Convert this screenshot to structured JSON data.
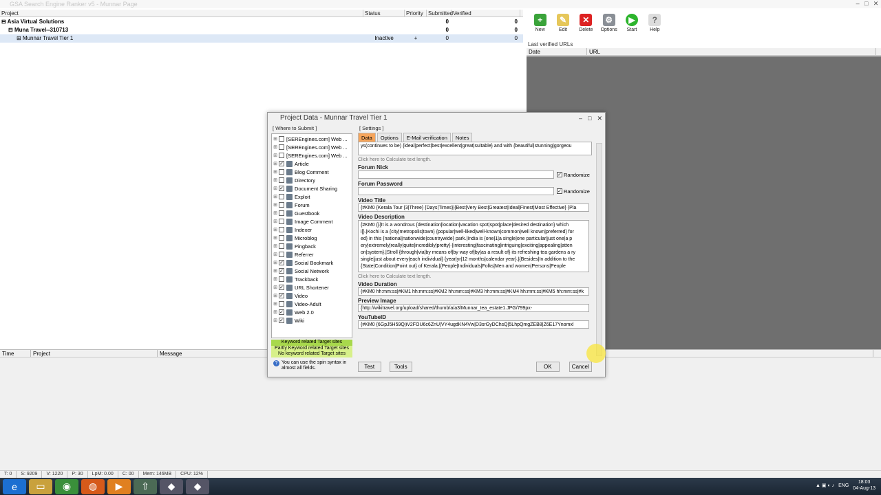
{
  "app_title": "GSA Search Engine Ranker v5 - Munnar Page",
  "projects": {
    "headers": [
      "Project",
      "Status",
      "Priority",
      "Submitted",
      "Verified"
    ],
    "rows": [
      {
        "name": "Asia Virtual Solutions",
        "status": "",
        "priority": "",
        "submitted": "0",
        "verified": "0",
        "indent": "0"
      },
      {
        "name": "Muna Travel--310713",
        "status": "",
        "priority": "",
        "submitted": "0",
        "verified": "0",
        "indent": "1"
      },
      {
        "name": "Munnar Travel Tier 1",
        "status": "Inactive",
        "priority": "+",
        "submitted": "0",
        "verified": "0",
        "indent": "2"
      }
    ]
  },
  "toolbar": {
    "new": "New",
    "edit": "Edit",
    "delete": "Delete",
    "options": "Options",
    "start": "Start",
    "help": "Help"
  },
  "last_verified": {
    "title": "Last verified URLs",
    "date": "Date",
    "url": "URL"
  },
  "log": {
    "time": "Time",
    "project": "Project",
    "message": "Message"
  },
  "status": [
    "T: 0",
    "S: 9209",
    "V: 1220",
    "P: 30",
    "LpM: 0.00",
    "C: 00",
    "Mem: 146MB",
    "CPU: 12%"
  ],
  "clock": {
    "time": "18:03",
    "date": "04-Aug-13",
    "lang": "ENG"
  },
  "dialog": {
    "title": "Project Data - Munnar Travel Tier 1",
    "where_label": "[ Where to Submit ]",
    "settings_label": "[ Settings ]",
    "tabs": [
      "Data",
      "Options",
      "E-Mail verification",
      "Notes"
    ],
    "tree": [
      {
        "label": "[SEREngines.com] Web ...",
        "checked": false
      },
      {
        "label": "[SEREngines.com] Web ...",
        "checked": false
      },
      {
        "label": "[SEREngines.com] Web ...",
        "checked": false
      },
      {
        "label": "Article",
        "checked": true
      },
      {
        "label": "Blog Comment",
        "checked": false
      },
      {
        "label": "Directory",
        "checked": false
      },
      {
        "label": "Document Sharing",
        "checked": true
      },
      {
        "label": "Exploit",
        "checked": false
      },
      {
        "label": "Forum",
        "checked": false
      },
      {
        "label": "Guestbook",
        "checked": false
      },
      {
        "label": "Image Comment",
        "checked": false
      },
      {
        "label": "Indexer",
        "checked": false
      },
      {
        "label": "Microblog",
        "checked": false
      },
      {
        "label": "Pingback",
        "checked": false
      },
      {
        "label": "Referrer",
        "checked": false
      },
      {
        "label": "Social Bookmark",
        "checked": true
      },
      {
        "label": "Social Network",
        "checked": true
      },
      {
        "label": "Trackback",
        "checked": false
      },
      {
        "label": "URL Shortener",
        "checked": true
      },
      {
        "label": "Video",
        "checked": true
      },
      {
        "label": "Video-Adult",
        "checked": false
      },
      {
        "label": "Web 2.0",
        "checked": true
      },
      {
        "label": "Wiki",
        "checked": true
      }
    ],
    "legend": [
      "Keyword related Target sites",
      "Partly Keyword related Target sites",
      "No keyword related Target sites"
    ],
    "spin_note": "You can use the spin syntax in almost all fields.",
    "top_text": "ys(continues to be) {ideal|perfect|best|excellent|great|suitable} and with {beautiful|stunning|gorgeou",
    "calc_hint": "Click here to Calculate text length.",
    "forum_nick": "Forum Nick",
    "forum_password": "Forum Password",
    "randomize": "Randomize",
    "video_title_label": "Video Title",
    "video_title": "{#KM0 {Kerala Tour {3|Three} {Days|Times}|{Best|Very Best|Greatest|Ideal|Finest|Most Effective} {Pla",
    "video_desc_label": "Video Description",
    "video_desc": "{#KM0 {{{It is a wondrous {destination|location|vacation spot|spot|place|desired destination} which i[}.|Kochi is a {city|metropolis|town} {popular|well-liked|well-known|common|well known|preferred} for ed} in this {national|nationwide|countrywide} park.|India is {one|1|a single|one particular|just one|a p ery|extremely|really|quite|incredibly|pretty} {interesting|fascinating|intriguing|exciting|appealing|atten on|system}.|Stroll {through|via|by means of|by way of|by|as a result of} its refreshing tea gardens a ry single|just about every|each individual} {year|yr|12 months|calendar year}.|{Besides|In addition to the {State|Condition|Point out} of Kerala.|{People|Individuals|Folks|Men and women|Persons|People",
    "video_duration_label": "Video Duration",
    "video_duration": "{#KM0 hh:mm:ss|#KM1 hh:mm:ss|#KM2 hh:mm:ss|#KM3 hh:mm:ss|#KM4 hh:mm:ss|#KM5 hh:mm:ss|#k",
    "preview_label": "Preview Image",
    "preview": "{http://wikitravel.org/upload/shared/thumb/a/a3/Munnar_tea_estate1.JPG/799px-",
    "youtube_label": "YouTubeID",
    "youtube": "{#KM0 {6GpJ5H59Q|iV2FOU6c6ZnU|VY4ugdKN4Vw|D3srGyDChsQ|5LhpQmgZEB8|Z6E17Ynomxl",
    "help": "Help",
    "buttons": {
      "test": "Test",
      "tools": "Tools",
      "ok": "OK",
      "cancel": "Cancel"
    }
  }
}
